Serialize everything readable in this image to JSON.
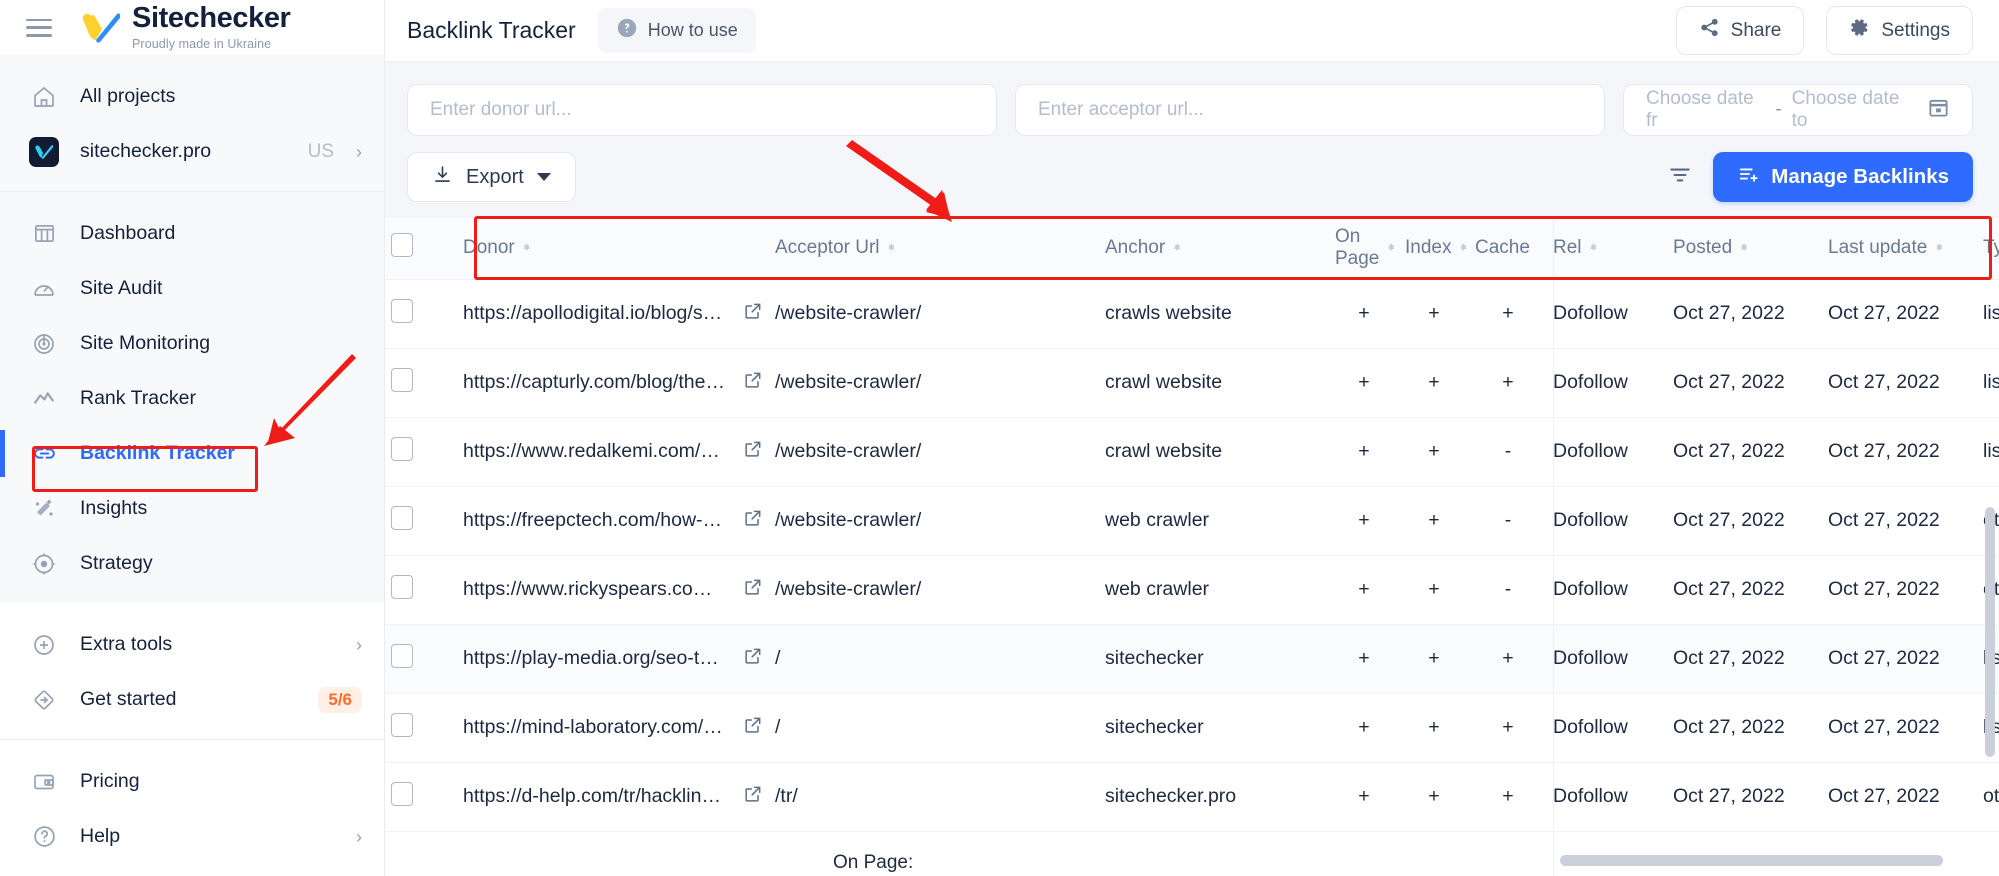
{
  "brand": {
    "name": "Sitechecker",
    "tagline": "Proudly made in Ukraine",
    "menu_icon": "hamburger-icon"
  },
  "sidebar": {
    "top": [
      {
        "label": "All projects",
        "icon": "home-icon"
      },
      {
        "label": "sitechecker.pro",
        "suffix": "US",
        "icon": "project-logo-icon",
        "chevron": "›"
      }
    ],
    "main": [
      {
        "label": "Dashboard",
        "icon": "dashboard-icon",
        "active": false
      },
      {
        "label": "Site Audit",
        "icon": "gauge-icon",
        "active": false
      },
      {
        "label": "Site Monitoring",
        "icon": "radar-icon",
        "active": false
      },
      {
        "label": "Rank Tracker",
        "icon": "trend-line-icon",
        "active": false
      },
      {
        "label": "Backlink Tracker",
        "icon": "link-icon",
        "active": true
      },
      {
        "label": "Insights",
        "icon": "magic-wand-icon",
        "active": false
      },
      {
        "label": "Strategy",
        "icon": "target-icon",
        "active": false
      }
    ],
    "secondary": [
      {
        "label": "Extra tools",
        "icon": "plus-circle-icon",
        "chevron": "›"
      },
      {
        "label": "Get started",
        "icon": "diamond-arrow-icon",
        "badge": "5/6"
      }
    ],
    "footer": [
      {
        "label": "Pricing",
        "icon": "wallet-icon"
      },
      {
        "label": "Help",
        "icon": "question-circle-icon",
        "chevron": "›"
      }
    ]
  },
  "topbar": {
    "title": "Backlink Tracker",
    "how_to_use": "How to use",
    "share": "Share",
    "settings": "Settings"
  },
  "filters": {
    "donor_placeholder": "Enter donor url...",
    "acceptor_placeholder": "Enter acceptor url...",
    "date_from": "Choose date fr",
    "date_sep": "-",
    "date_to": "Choose date to"
  },
  "toolbar": {
    "export": "Export",
    "manage_backlinks": "Manage Backlinks",
    "filter_icon": "filter-icon"
  },
  "table": {
    "columns": [
      {
        "label": "Donor",
        "sortable": true
      },
      {
        "label": "Acceptor Url",
        "sortable": true
      },
      {
        "label": "Anchor",
        "sortable": true
      },
      {
        "label": "On Page",
        "sortable": true
      },
      {
        "label": "Index",
        "sortable": true
      },
      {
        "label": "Cache",
        "sortable": true
      },
      {
        "label": "Rel",
        "sortable": true
      },
      {
        "label": "Posted",
        "sortable": true
      },
      {
        "label": "Last update",
        "sortable": true
      },
      {
        "label": "Type",
        "sortable": true
      }
    ],
    "rows": [
      {
        "donor": "https://apollodigital.io/blog/seo...",
        "acceptor": "/website-crawler/",
        "anchor": "crawls website",
        "on_page": "+",
        "index": "+",
        "cache": "+",
        "rel": "Dofollow",
        "posted": "Oct 27, 2022",
        "last_update": "Oct 27, 2022",
        "type": "listing"
      },
      {
        "donor": "https://capturly.com/blog/the-1...",
        "acceptor": "/website-crawler/",
        "anchor": "crawl website",
        "on_page": "+",
        "index": "+",
        "cache": "+",
        "rel": "Dofollow",
        "posted": "Oct 27, 2022",
        "last_update": "Oct 27, 2022",
        "type": "listing"
      },
      {
        "donor": "https://www.redalkemi.com/bl...",
        "acceptor": "/website-crawler/",
        "anchor": "crawl website",
        "on_page": "+",
        "index": "+",
        "cache": "-",
        "rel": "Dofollow",
        "posted": "Oct 27, 2022",
        "last_update": "Oct 27, 2022",
        "type": "listing"
      },
      {
        "donor": "https://freepctech.com/how-to...",
        "acceptor": "/website-crawler/",
        "anchor": "web crawler",
        "on_page": "+",
        "index": "+",
        "cache": "-",
        "rel": "Dofollow",
        "posted": "Oct 27, 2022",
        "last_update": "Oct 27, 2022",
        "type": "other"
      },
      {
        "donor": "https://www.rickyspears.com/...",
        "acceptor": "/website-crawler/",
        "anchor": "web crawler",
        "on_page": "+",
        "index": "+",
        "cache": "-",
        "rel": "Dofollow",
        "posted": "Oct 27, 2022",
        "last_update": "Oct 27, 2022",
        "type": "other"
      },
      {
        "donor": "https://play-media.org/seo-tool...",
        "acceptor": "/",
        "anchor": "sitechecker",
        "on_page": "+",
        "index": "+",
        "cache": "+",
        "rel": "Dofollow",
        "posted": "Oct 27, 2022",
        "last_update": "Oct 27, 2022",
        "type": "listing"
      },
      {
        "donor": "https://mind-laboratory.com/2...",
        "acceptor": "/",
        "anchor": "sitechecker",
        "on_page": "+",
        "index": "+",
        "cache": "+",
        "rel": "Dofollow",
        "posted": "Oct 27, 2022",
        "last_update": "Oct 27, 2022",
        "type": "listing"
      },
      {
        "donor": "https://d-help.com/tr/hacklink-...",
        "acceptor": "/tr/",
        "anchor": "sitechecker.pro",
        "on_page": "+",
        "index": "+",
        "cache": "+",
        "rel": "Dofollow",
        "posted": "Oct 27, 2022",
        "last_update": "Oct 27, 2022",
        "type": "other"
      }
    ],
    "footer_partial": "On Page:"
  },
  "annotations": {
    "highlight_color": "#f01c18",
    "arrow_to_backlink_tracker": "red-arrow-icon",
    "arrow_to_table_header": "red-arrow-icon",
    "box_sidebar_item": "Backlink Tracker",
    "box_table_header": "table header row"
  },
  "colors": {
    "accent": "#2f6bff",
    "annotation": "#f01c18",
    "badge": "#ff6b2c",
    "text": "#15213b"
  }
}
